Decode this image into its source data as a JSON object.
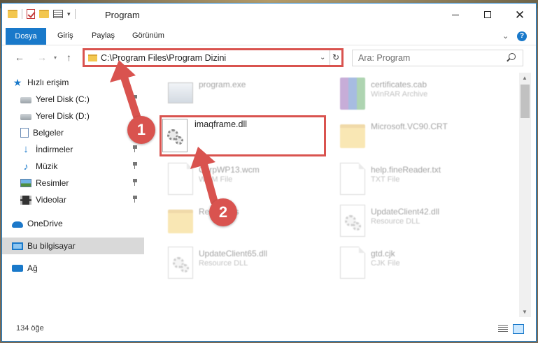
{
  "window": {
    "title": "Program",
    "minimize_glyph": "",
    "maximize_glyph": "",
    "close_glyph": "✕"
  },
  "ribbon": {
    "tabs": [
      "Dosya",
      "Giriş",
      "Paylaş",
      "Görünüm"
    ],
    "accent": "#1979ca"
  },
  "nav": {
    "address": "C:\\Program Files\\Program Dizini",
    "search_placeholder": "Ara: Program"
  },
  "sidebar": {
    "items": [
      {
        "label": "Hızlı erişim",
        "icon": "star-icon",
        "pinned": false
      },
      {
        "label": "Yerel Disk (C:)",
        "icon": "drive-icon",
        "pinned": true
      },
      {
        "label": "Yerel Disk (D:)",
        "icon": "drive-icon",
        "pinned": true
      },
      {
        "label": "Belgeler",
        "icon": "documents-icon",
        "pinned": true
      },
      {
        "label": "İndirmeler",
        "icon": "download-icon",
        "pinned": true
      },
      {
        "label": "Müzik",
        "icon": "music-icon",
        "pinned": true
      },
      {
        "label": "Resimler",
        "icon": "pictures-icon",
        "pinned": true
      },
      {
        "label": "Videolar",
        "icon": "videos-icon",
        "pinned": true
      },
      {
        "label": "OneDrive",
        "icon": "onedrive-icon",
        "pinned": false
      },
      {
        "label": "Bu bilgisayar",
        "icon": "this-pc-icon",
        "pinned": false
      },
      {
        "label": "Ağ",
        "icon": "network-icon",
        "pinned": false
      }
    ]
  },
  "files": [
    {
      "name": "program.exe",
      "type": "",
      "icon": "exe-icon"
    },
    {
      "name": "certificates.cab",
      "type": "WinRAR Archive",
      "icon": "winrar-icon"
    },
    {
      "name": "imaqframe.dll",
      "type": "",
      "icon": "dll-gear-icon",
      "highlighted": true
    },
    {
      "name": "Microsoft.VC90.CRT",
      "type": "",
      "icon": "folder-icon"
    },
    {
      "name": "CorpWP13.wcm",
      "type": "WCM File",
      "icon": "file-icon"
    },
    {
      "name": "help.fineReader.txt",
      "type": "TXT File",
      "icon": "file-icon"
    },
    {
      "name": "Resources",
      "type": "",
      "icon": "folder-icon"
    },
    {
      "name": "UpdateClient42.dll",
      "type": "Resource DLL",
      "icon": "dll-gear-icon"
    },
    {
      "name": "UpdateClient65.dll",
      "type": "Resource DLL",
      "icon": "dll-gear-icon"
    },
    {
      "name": "gtd.cjk",
      "type": "CJK File",
      "icon": "file-icon"
    }
  ],
  "annotations": {
    "step1": "1",
    "step2": "2",
    "color": "#d9534f"
  },
  "status": {
    "item_count": "134 öğe"
  }
}
